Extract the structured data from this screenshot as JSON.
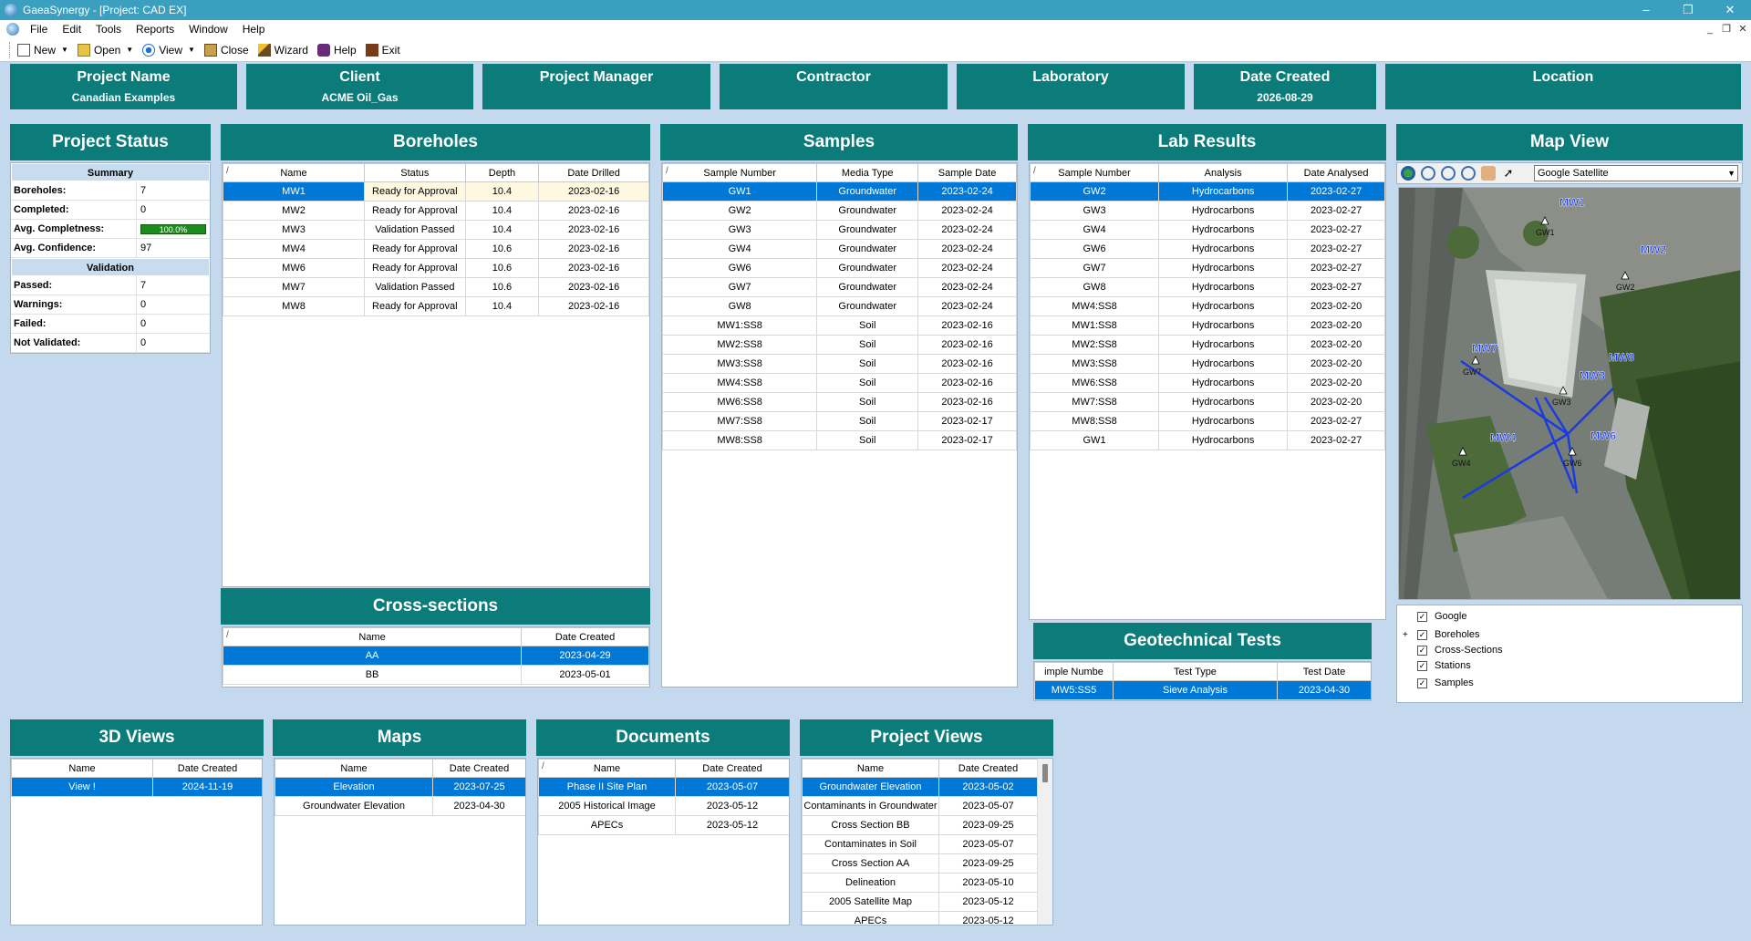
{
  "window": {
    "title": "GaeaSynergy - [Project: CAD EX]",
    "controls": [
      "–",
      "❐",
      "✕"
    ],
    "mdi_controls": [
      "_",
      "❐",
      "✕"
    ]
  },
  "menu": [
    "File",
    "Edit",
    "Tools",
    "Reports",
    "Window",
    "Help"
  ],
  "toolbar": {
    "new": "New",
    "open": "Open",
    "view": "View",
    "close": "Close",
    "wizard": "Wizard",
    "help": "Help",
    "exit": "Exit"
  },
  "header": {
    "project_name_label": "Project Name",
    "project_name": "Canadian Examples",
    "client_label": "Client",
    "client": "ACME Oil_Gas",
    "pm_label": "Project Manager",
    "pm": "",
    "contractor_label": "Contractor",
    "contractor": "",
    "lab_label": "Laboratory",
    "lab": "",
    "date_label": "Date Created",
    "date": "2026-08-29",
    "location_label": "Location",
    "location": ""
  },
  "project_status": {
    "title": "Project Status",
    "summary_label": "Summary",
    "rows": [
      {
        "k": "Boreholes:",
        "v": "7"
      },
      {
        "k": "Completed:",
        "v": "0"
      },
      {
        "k": "Avg. Completness:",
        "v": "100.0%"
      },
      {
        "k": "Avg. Confidence:",
        "v": "97"
      }
    ],
    "completeness_fraction": 1.0,
    "validation_label": "Validation",
    "vrows": [
      {
        "k": "Passed:",
        "v": "7"
      },
      {
        "k": "Warnings:",
        "v": "0"
      },
      {
        "k": "Failed:",
        "v": "0"
      },
      {
        "k": "Not Validated:",
        "v": "0"
      }
    ]
  },
  "boreholes": {
    "title": "Boreholes",
    "cols": [
      "Name",
      "Status",
      "Depth",
      "Date Drilled"
    ],
    "rows": [
      [
        "MW1",
        "Ready for Approval",
        "10.4",
        "2023-02-16"
      ],
      [
        "MW2",
        "Ready for Approval",
        "10.4",
        "2023-02-16"
      ],
      [
        "MW3",
        "Validation Passed",
        "10.4",
        "2023-02-16"
      ],
      [
        "MW4",
        "Ready for Approval",
        "10.6",
        "2023-02-16"
      ],
      [
        "MW6",
        "Ready for Approval",
        "10.6",
        "2023-02-16"
      ],
      [
        "MW7",
        "Validation Passed",
        "10.6",
        "2023-02-16"
      ],
      [
        "MW8",
        "Ready for Approval",
        "10.4",
        "2023-02-16"
      ]
    ]
  },
  "samples": {
    "title": "Samples",
    "cols": [
      "Sample Number",
      "Media Type",
      "Sample Date"
    ],
    "rows": [
      [
        "GW1",
        "Groundwater",
        "2023-02-24"
      ],
      [
        "GW2",
        "Groundwater",
        "2023-02-24"
      ],
      [
        "GW3",
        "Groundwater",
        "2023-02-24"
      ],
      [
        "GW4",
        "Groundwater",
        "2023-02-24"
      ],
      [
        "GW6",
        "Groundwater",
        "2023-02-24"
      ],
      [
        "GW7",
        "Groundwater",
        "2023-02-24"
      ],
      [
        "GW8",
        "Groundwater",
        "2023-02-24"
      ],
      [
        "MW1:SS8",
        "Soil",
        "2023-02-16"
      ],
      [
        "MW2:SS8",
        "Soil",
        "2023-02-16"
      ],
      [
        "MW3:SS8",
        "Soil",
        "2023-02-16"
      ],
      [
        "MW4:SS8",
        "Soil",
        "2023-02-16"
      ],
      [
        "MW6:SS8",
        "Soil",
        "2023-02-16"
      ],
      [
        "MW7:SS8",
        "Soil",
        "2023-02-17"
      ],
      [
        "MW8:SS8",
        "Soil",
        "2023-02-17"
      ]
    ]
  },
  "lab_results": {
    "title": "Lab Results",
    "cols": [
      "Sample Number",
      "Analysis",
      "Date Analysed"
    ],
    "rows": [
      [
        "GW2",
        "Hydrocarbons",
        "2023-02-27"
      ],
      [
        "GW3",
        "Hydrocarbons",
        "2023-02-27"
      ],
      [
        "GW4",
        "Hydrocarbons",
        "2023-02-27"
      ],
      [
        "GW6",
        "Hydrocarbons",
        "2023-02-27"
      ],
      [
        "GW7",
        "Hydrocarbons",
        "2023-02-27"
      ],
      [
        "GW8",
        "Hydrocarbons",
        "2023-02-27"
      ],
      [
        "MW4:SS8",
        "Hydrocarbons",
        "2023-02-20"
      ],
      [
        "MW1:SS8",
        "Hydrocarbons",
        "2023-02-20"
      ],
      [
        "MW2:SS8",
        "Hydrocarbons",
        "2023-02-20"
      ],
      [
        "MW3:SS8",
        "Hydrocarbons",
        "2023-02-20"
      ],
      [
        "MW6:SS8",
        "Hydrocarbons",
        "2023-02-20"
      ],
      [
        "MW7:SS8",
        "Hydrocarbons",
        "2023-02-20"
      ],
      [
        "MW8:SS8",
        "Hydrocarbons",
        "2023-02-27"
      ],
      [
        "GW1",
        "Hydrocarbons",
        "2023-02-27"
      ]
    ]
  },
  "map_view": {
    "title": "Map View",
    "basemap": "Google Satellite",
    "labels": [
      "MW1",
      "GW1",
      "MW2",
      "GW2",
      "MW7",
      "GW7",
      "MW8",
      "MW3",
      "GW3",
      "MW4",
      "GW4",
      "MW6",
      "GW6"
    ],
    "layers": [
      "Google",
      "Boreholes",
      "Cross-Sections",
      "Stations",
      "Samples"
    ]
  },
  "cross_sections": {
    "title": "Cross-sections",
    "cols": [
      "Name",
      "Date Created"
    ],
    "rows": [
      [
        "AA",
        "2023-04-29"
      ],
      [
        "BB",
        "2023-05-01"
      ]
    ]
  },
  "geotech": {
    "title": "Geotechnical Tests",
    "cols": [
      "imple Numbe",
      "Test Type",
      "Test Date"
    ],
    "rows": [
      [
        "MW5:SS5",
        "Sieve Analysis",
        "2023-04-30"
      ]
    ]
  },
  "views3d": {
    "title": "3D Views",
    "cols": [
      "Name",
      "Date Created"
    ],
    "rows": [
      [
        "View !",
        "2024-11-19"
      ]
    ]
  },
  "maps": {
    "title": "Maps",
    "cols": [
      "Name",
      "Date Created"
    ],
    "rows": [
      [
        "Elevation",
        "2023-07-25"
      ],
      [
        "Groundwater Elevation",
        "2023-04-30"
      ]
    ]
  },
  "documents": {
    "title": "Documents",
    "cols": [
      "Name",
      "Date Created"
    ],
    "rows": [
      [
        "Phase II Site Plan",
        "2023-05-07"
      ],
      [
        "2005 Historical Image",
        "2023-05-12"
      ],
      [
        "APECs",
        "2023-05-12"
      ]
    ]
  },
  "project_views": {
    "title": "Project Views",
    "cols": [
      "Name",
      "Date Created"
    ],
    "rows": [
      [
        "Groundwater Elevation",
        "2023-05-02"
      ],
      [
        "Contaminants in Groundwater",
        "2023-05-07"
      ],
      [
        "Cross Section BB",
        "2023-09-25"
      ],
      [
        "Contaminates in Soil",
        "2023-05-07"
      ],
      [
        "Cross Section AA",
        "2023-09-25"
      ],
      [
        "Delineation",
        "2023-05-10"
      ],
      [
        "2005 Satellite Map",
        "2023-05-12"
      ],
      [
        "APECs",
        "2023-05-12"
      ]
    ]
  }
}
